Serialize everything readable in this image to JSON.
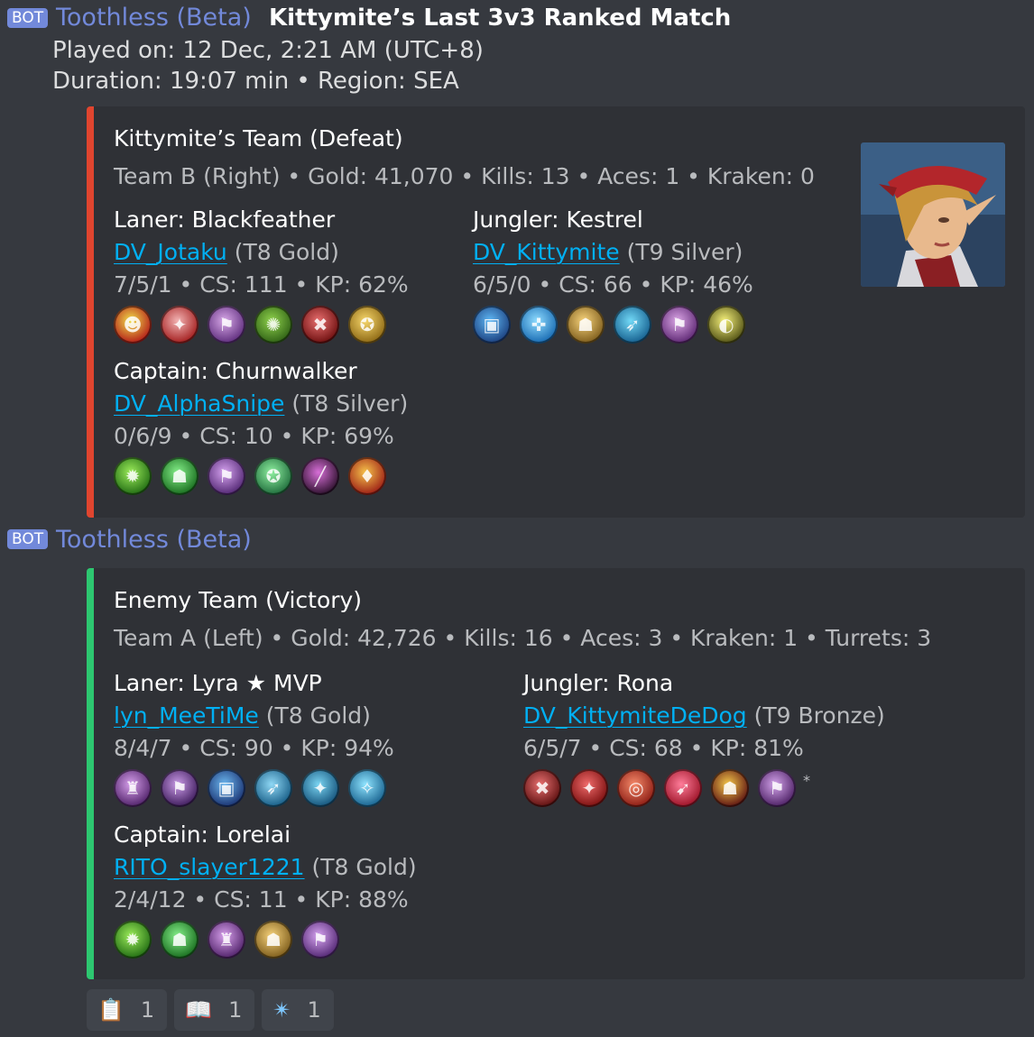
{
  "message1": {
    "bot_tag": "BOT",
    "author": "Toothless (Beta)",
    "title": "Kittymite’s Last 3v3 Ranked Match",
    "played_on": "Played on: 12 Dec, 2:21 AM (UTC+8)",
    "duration": "Duration: 19:07 min • Region: SEA",
    "embed": {
      "accent": "#e0452f",
      "title": "Kittymite’s Team (Defeat)",
      "subtitle": "Team B (Right) • Gold: 41,070 • Kills: 13 • Aces: 1 • Kraken: 0",
      "thumbnail_icon": "hero-portrait-kestrel",
      "fields": [
        {
          "name": "Laner: Blackfeather",
          "player": "DV_Jotaku",
          "tier": "(T8 Gold)",
          "stats": "7/5/1 • CS: 111 • KP: 62%",
          "items": [
            {
              "icon": "tension-bow-icon",
              "c1": "#f1e04a",
              "c2": "#b21818",
              "glyph": "☻"
            },
            {
              "icon": "serpent-mask-icon",
              "c1": "#f3b4b4",
              "c2": "#a11a1a",
              "glyph": "✦"
            },
            {
              "icon": "travel-boots-icon",
              "c1": "#d8a8e8",
              "c2": "#5b2a7a",
              "glyph": "⚑"
            },
            {
              "icon": "breaking-point-icon",
              "c1": "#8fd24c",
              "c2": "#2d5e14",
              "glyph": "✺"
            },
            {
              "icon": "sorrowblade-icon",
              "c1": "#e86f6f",
              "c2": "#6b0d0d",
              "glyph": "✖"
            },
            {
              "icon": "tornado-trigger-icon",
              "c1": "#f6d66a",
              "c2": "#8a6512",
              "glyph": "✪"
            }
          ]
        },
        {
          "name": "Jungler: Kestrel",
          "player": "DV_Kittymite",
          "tier": "(T9 Silver)",
          "stats": "6/5/0 • CS: 66 • KP: 46%",
          "items": [
            {
              "icon": "aftershock-icon",
              "c1": "#5fb8f5",
              "c2": "#1a3d7c",
              "glyph": "▣"
            },
            {
              "icon": "clockwork-icon",
              "c1": "#8fdcff",
              "c2": "#1467b0",
              "glyph": "✜"
            },
            {
              "icon": "fountain-of-renewal-icon",
              "c1": "#f6d27a",
              "c2": "#7b5a1a",
              "glyph": "☗"
            },
            {
              "icon": "shatterglass-icon",
              "c1": "#72d9f7",
              "c2": "#135c8c",
              "glyph": "➶"
            },
            {
              "icon": "journey-boots-icon",
              "c1": "#dba6e6",
              "c2": "#5a2470",
              "glyph": "⚑"
            },
            {
              "icon": "flare-gun-icon",
              "c1": "#f5f07a",
              "c2": "#4d4d12",
              "glyph": "◐"
            }
          ]
        },
        {
          "name": "Captain: Churnwalker",
          "player": "DV_AlphaSnipe",
          "tier": "(T8 Silver)",
          "stats": "0/6/9 • CS: 10 • KP: 69%",
          "items": [
            {
              "icon": "contraption-icon",
              "c1": "#9cec5a",
              "c2": "#1f6a12",
              "glyph": "✹"
            },
            {
              "icon": "fountain-icon",
              "c1": "#86f08a",
              "c2": "#166a1c",
              "glyph": "☗"
            },
            {
              "icon": "war-treads-icon",
              "c1": "#d6a3f0",
              "c2": "#4f2470",
              "glyph": "⚑"
            },
            {
              "icon": "crucible-icon",
              "c1": "#8ff0a0",
              "c2": "#1d6a3a",
              "glyph": "✪"
            },
            {
              "icon": "scout-trap-icon",
              "c1": "#d86fd8",
              "c2": "#2a0f2a",
              "glyph": "╱"
            },
            {
              "icon": "flare-icon",
              "c1": "#f6c24a",
              "c2": "#9a1a14",
              "glyph": "♦"
            }
          ]
        }
      ]
    }
  },
  "message2": {
    "bot_tag": "BOT",
    "author": "Toothless (Beta)",
    "embed": {
      "accent": "#2dc770",
      "title": "Enemy Team (Victory)",
      "subtitle": "Team A (Left) • Gold: 42,726 • Kills: 16 • Aces: 3 • Kraken: 1 • Turrets: 3",
      "fields": [
        {
          "name": "Laner: Lyra ★ MVP",
          "player": "lyn_MeeTiMe",
          "tier": "(T8 Gold)",
          "stats": "8/4/7 • CS: 90 • KP: 94%",
          "items": [
            {
              "icon": "halcyon-chargers-icon",
              "c1": "#d7a0ec",
              "c2": "#4d1f66",
              "glyph": "♜"
            },
            {
              "icon": "war-treads-icon",
              "c1": "#c99ae6",
              "c2": "#3c1a5a",
              "glyph": "⚑"
            },
            {
              "icon": "aftershock-icon",
              "c1": "#6cb8f0",
              "c2": "#182f6e",
              "glyph": "▣"
            },
            {
              "icon": "eve-of-harvest-icon",
              "c1": "#8fd8f5",
              "c2": "#145a84",
              "glyph": "➶"
            },
            {
              "icon": "shatterglass-icon",
              "c1": "#7ad4f2",
              "c2": "#125078",
              "glyph": "✦"
            },
            {
              "icon": "frostburn-icon",
              "c1": "#8fe4ff",
              "c2": "#155f8c",
              "glyph": "✧"
            }
          ]
        },
        {
          "name": "Jungler: Rona",
          "player": "DV_KittymiteDeDog",
          "tier": "(T9 Bronze)",
          "stats": "6/5/7 • CS: 68 • KP: 81%",
          "items": [
            {
              "icon": "sorrowblade-icon",
              "c1": "#e87070",
              "c2": "#5a0e0e",
              "glyph": "✖"
            },
            {
              "icon": "tension-bow-icon",
              "c1": "#ef6a6a",
              "c2": "#7a0e0e",
              "glyph": "✦"
            },
            {
              "icon": "bonesaw-icon",
              "c1": "#f58a6a",
              "c2": "#8a1a12",
              "glyph": "◎"
            },
            {
              "icon": "tyrants-monocle-icon",
              "c1": "#ff7d9a",
              "c2": "#9a1024",
              "glyph": "➹"
            },
            {
              "icon": "breaking-point-icon",
              "c1": "#f5c84a",
              "c2": "#5a1010",
              "glyph": "☗"
            },
            {
              "icon": "journey-boots-icon",
              "c1": "#d3a3ea",
              "c2": "#4a1e62",
              "glyph": "⚑"
            }
          ],
          "marker": "*"
        },
        {
          "name": "Captain: Lorelai",
          "player": "RITO_slayer1221",
          "tier": "(T8 Gold)",
          "stats": "2/4/12 • CS: 11 • KP: 88%",
          "items": [
            {
              "icon": "contraption-icon",
              "c1": "#9cec5a",
              "c2": "#1f6a12",
              "glyph": "✹"
            },
            {
              "icon": "fountain-icon",
              "c1": "#86f08a",
              "c2": "#166a1c",
              "glyph": "☗"
            },
            {
              "icon": "halcyon-chargers-icon",
              "c1": "#d7a0ec",
              "c2": "#4d1f66",
              "glyph": "♜"
            },
            {
              "icon": "fountain-of-renewal-icon",
              "c1": "#f6d27a",
              "c2": "#7b5a1a",
              "glyph": "☗"
            },
            {
              "icon": "war-treads-icon",
              "c1": "#d6a3f0",
              "c2": "#4f2470",
              "glyph": "⚑"
            }
          ]
        }
      ]
    }
  },
  "reactions": [
    {
      "icon": "clipboard-emoji",
      "emoji": "📋",
      "count": "1"
    },
    {
      "icon": "book-emoji",
      "emoji": "📖",
      "count": "1"
    },
    {
      "icon": "sparkle-emoji",
      "emoji": "✴",
      "count": "1"
    }
  ]
}
